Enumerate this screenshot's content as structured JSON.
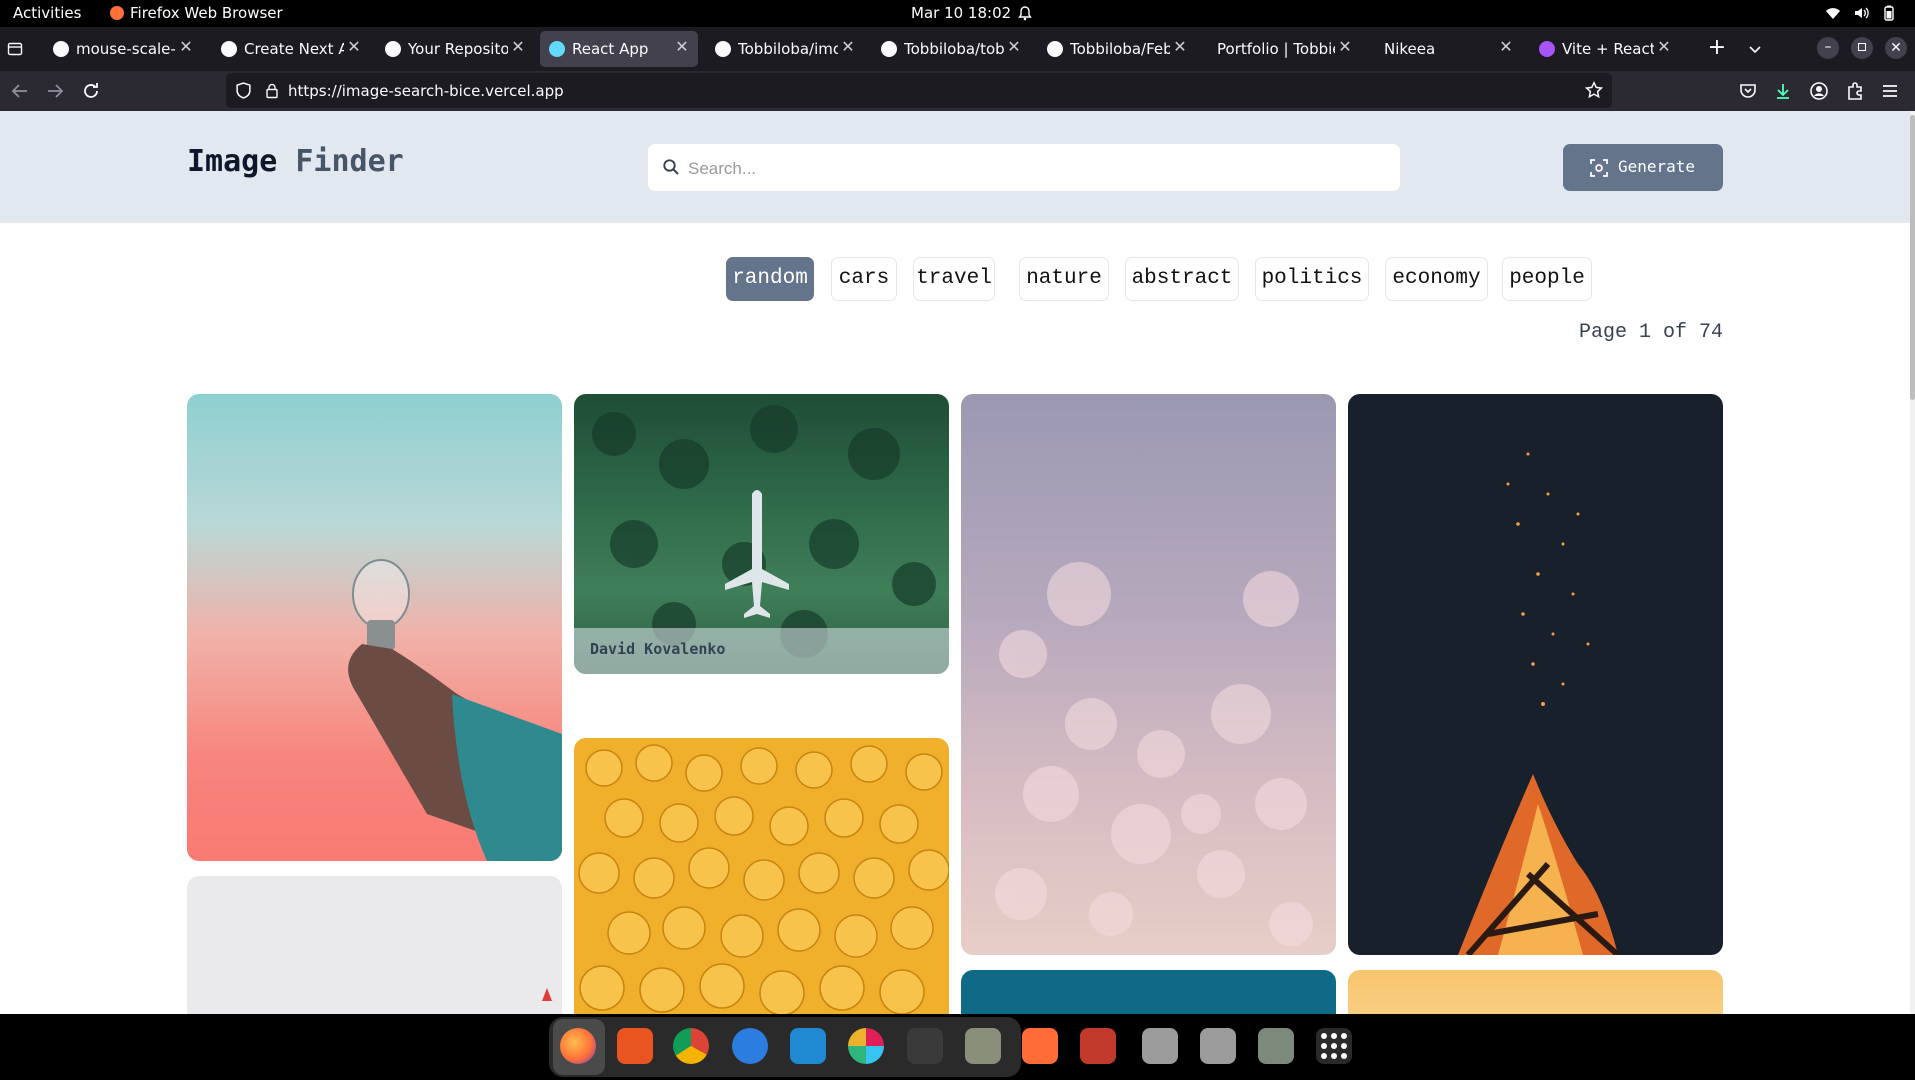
{
  "system": {
    "activities": "Activities",
    "app_name": "Firefox Web Browser",
    "datetime": "Mar 10  18:02"
  },
  "browser": {
    "tabs": [
      {
        "label": "mouse-scale-im",
        "icon": "github-icon",
        "active": false
      },
      {
        "label": "Create Next Ap",
        "icon": "vercel-icon",
        "active": false
      },
      {
        "label": "Your Repositori",
        "icon": "github-icon",
        "active": false
      },
      {
        "label": "React App",
        "icon": "react-icon",
        "active": true
      },
      {
        "label": "Tobbiloba/imos",
        "icon": "github-icon",
        "active": false
      },
      {
        "label": "Tobbiloba/tobbi",
        "icon": "github-icon",
        "active": false
      },
      {
        "label": "Tobbiloba/Febt",
        "icon": "github-icon",
        "active": false
      },
      {
        "label": "Portfolio | Tobbie",
        "icon": "none",
        "active": false
      },
      {
        "label": "Nikeea",
        "icon": "none",
        "active": false
      },
      {
        "label": "Vite + React",
        "icon": "vite-icon",
        "active": false
      }
    ],
    "url": "https://image-search-bice.vercel.app"
  },
  "app": {
    "title_part1": "Image",
    "title_part2": "Finder",
    "search_placeholder": "Search...",
    "generate_label": "Generate",
    "categories": [
      "random",
      "cars",
      "travel",
      "nature",
      "abstract",
      "politics",
      "economy",
      "people"
    ],
    "selected_category": "random",
    "page_info": "Page 1 of 74",
    "images": [
      {
        "subject": "lightbulb-in-hand",
        "caption": ""
      },
      {
        "subject": "plane-in-forest",
        "caption": "David Kovalenko"
      },
      {
        "subject": "bokeh-lights",
        "caption": ""
      },
      {
        "subject": "campfire-sparks",
        "caption": ""
      },
      {
        "subject": "white-minimal",
        "caption": ""
      },
      {
        "subject": "lego-heads",
        "caption": ""
      },
      {
        "subject": "teal-background",
        "caption": ""
      },
      {
        "subject": "yellow-background",
        "caption": ""
      }
    ]
  },
  "colors": {
    "header_bg": "#e2e8f0",
    "accent": "#64748b",
    "title_accent": "#475569"
  },
  "dock": {
    "apps": [
      "firefox-icon",
      "app-center-icon",
      "chrome-icon",
      "help-icon",
      "vscode-icon",
      "slack-icon",
      "terminal-icon",
      "files-icon",
      "postman-icon",
      "screen-recorder-icon",
      "ssd-drive-icon",
      "ssd-drive-icon",
      "trash-icon",
      "app-grid-icon"
    ]
  }
}
